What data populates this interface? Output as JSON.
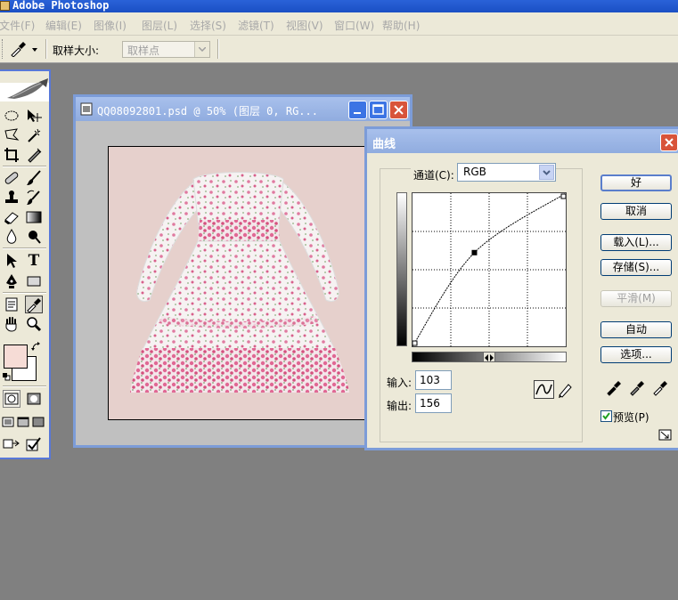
{
  "app": {
    "title": "Adobe Photoshop"
  },
  "menu": [
    "文件(F)",
    "编辑(E)",
    "图像(I)",
    "图层(L)",
    "选择(S)",
    "滤镜(T)",
    "视图(V)",
    "窗口(W)",
    "帮助(H)"
  ],
  "options_bar": {
    "tool_icon": "eyedropper-icon",
    "sample_size_label": "取样大小:",
    "sample_size_value": "取样点"
  },
  "document": {
    "title": "QQ08092801.psd @ 50% (图层 0, RG..."
  },
  "toolbox": {
    "foreground_color": "#f6dcd6",
    "background_color": "#ffffff",
    "selected_tool": "eyedropper"
  },
  "curves": {
    "title": "曲线",
    "channel_label": "通道(C):",
    "channel_value": "RGB",
    "input_label": "输入:",
    "input_value": "103",
    "output_label": "输出:",
    "output_value": "156",
    "buttons": {
      "ok": "好",
      "cancel": "取消",
      "load": "载入(L)...",
      "save": "存储(S)...",
      "smooth": "平滑(M)",
      "auto": "自动",
      "options": "选项..."
    },
    "preview_label": "预览(P)",
    "preview_checked": true,
    "points": [
      [
        0,
        0
      ],
      [
        103,
        156
      ],
      [
        255,
        255
      ]
    ],
    "selected_point": [
      103,
      156
    ]
  },
  "colors": {
    "titlebar": "#1a4fc4",
    "inactive_title": "#90acdf",
    "workspace": "#808080",
    "dialog_bg": "#ece9d8"
  }
}
